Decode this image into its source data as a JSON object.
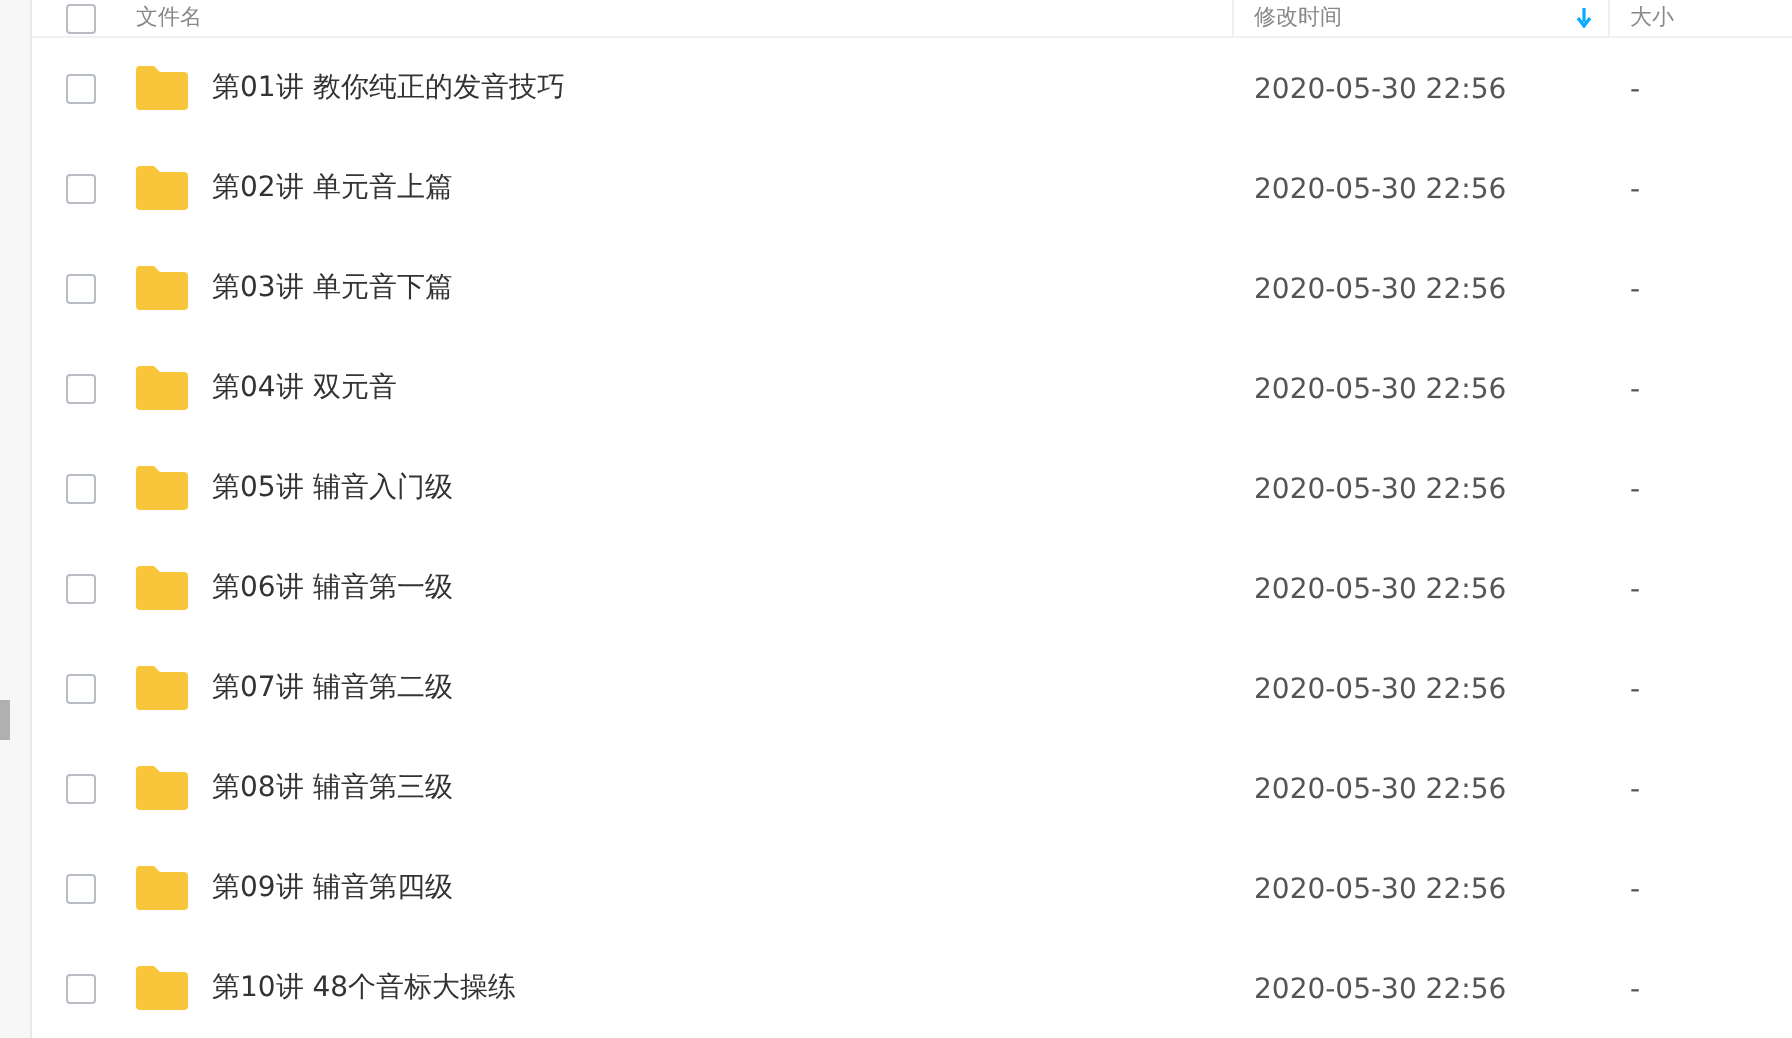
{
  "table": {
    "select_all_checked": false,
    "columns": [
      {
        "label": "文件名",
        "sorted": false
      },
      {
        "label": "修改时间",
        "sorted": true
      },
      {
        "label": "大小",
        "sorted": false
      }
    ],
    "rows": [
      {
        "name": "第01讲 教你纯正的发音技巧",
        "modified": "2020-05-30 22:56",
        "size": "-",
        "checked": false
      },
      {
        "name": "第02讲 单元音上篇",
        "modified": "2020-05-30 22:56",
        "size": "-",
        "checked": false
      },
      {
        "name": "第03讲 单元音下篇",
        "modified": "2020-05-30 22:56",
        "size": "-",
        "checked": false
      },
      {
        "name": "第04讲 双元音",
        "modified": "2020-05-30 22:56",
        "size": "-",
        "checked": false
      },
      {
        "name": "第05讲 辅音入门级",
        "modified": "2020-05-30 22:56",
        "size": "-",
        "checked": false
      },
      {
        "name": "第06讲 辅音第一级",
        "modified": "2020-05-30 22:56",
        "size": "-",
        "checked": false
      },
      {
        "name": "第07讲 辅音第二级",
        "modified": "2020-05-30 22:56",
        "size": "-",
        "checked": false
      },
      {
        "name": "第08讲 辅音第三级",
        "modified": "2020-05-30 22:56",
        "size": "-",
        "checked": false
      },
      {
        "name": "第09讲 辅音第四级",
        "modified": "2020-05-30 22:56",
        "size": "-",
        "checked": false
      },
      {
        "name": "第10讲 48个音标大操练",
        "modified": "2020-05-30 22:56",
        "size": "-",
        "checked": false
      }
    ]
  }
}
